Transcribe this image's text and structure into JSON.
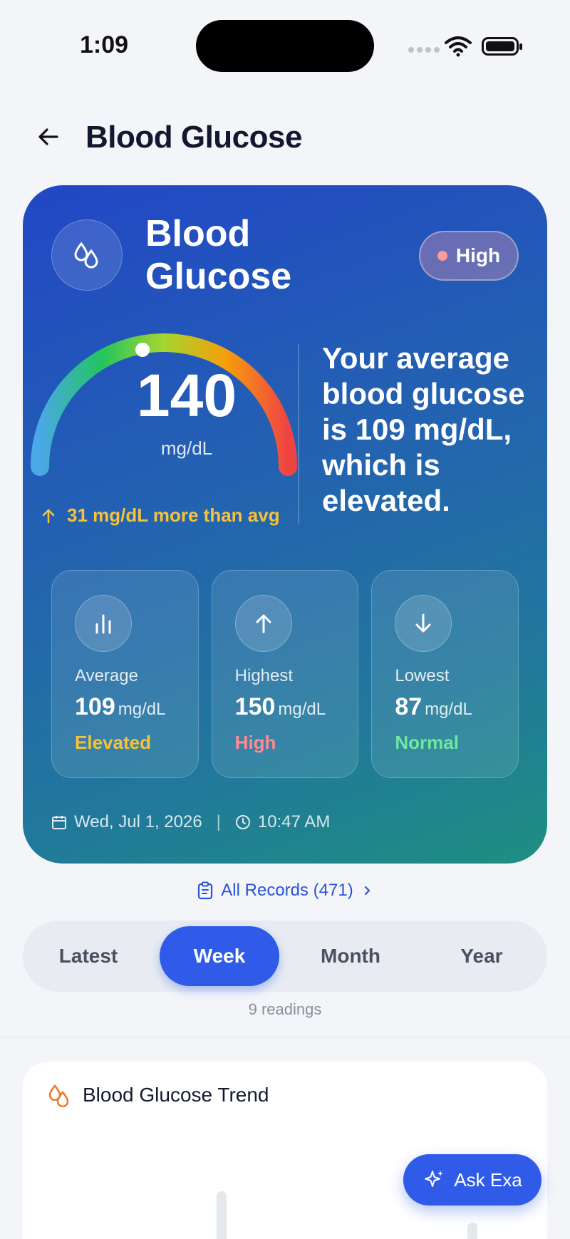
{
  "status_bar": {
    "time": "1:09"
  },
  "header": {
    "title": "Blood Glucose"
  },
  "hero": {
    "title": "Blood Glucose",
    "badge": "High",
    "reading": {
      "value": "140",
      "unit": "mg/dL"
    },
    "delta_text": "31 mg/dL more than avg",
    "summary": "Your average blood glucose is 109 mg/dL, which is elevated.",
    "stats": [
      {
        "label": "Average",
        "value": "109",
        "unit": "mg/dL",
        "status": "Elevated",
        "status_color": "#f7c23a",
        "icon": "bar-chart-icon"
      },
      {
        "label": "Highest",
        "value": "150",
        "unit": "mg/dL",
        "status": "High",
        "status_color": "#ff8a95",
        "icon": "arrow-up-icon"
      },
      {
        "label": "Lowest",
        "value": "87",
        "unit": "mg/dL",
        "status": "Normal",
        "status_color": "#6ee7a0",
        "icon": "arrow-down-icon"
      }
    ],
    "date": "Wed, Jul 1, 2026",
    "time": "10:47 AM"
  },
  "records_link": "All Records (471)",
  "tabs": [
    {
      "label": "Latest",
      "active": false
    },
    {
      "label": "Week",
      "active": true
    },
    {
      "label": "Month",
      "active": false
    },
    {
      "label": "Year",
      "active": false
    }
  ],
  "readings_count": "9 readings",
  "trend": {
    "title": "Blood Glucose Trend"
  },
  "ask_button": "Ask Exa",
  "colors": {
    "accent": "#2f5be8",
    "hero_start": "#2247c6",
    "hero_end": "#1e8f80"
  }
}
